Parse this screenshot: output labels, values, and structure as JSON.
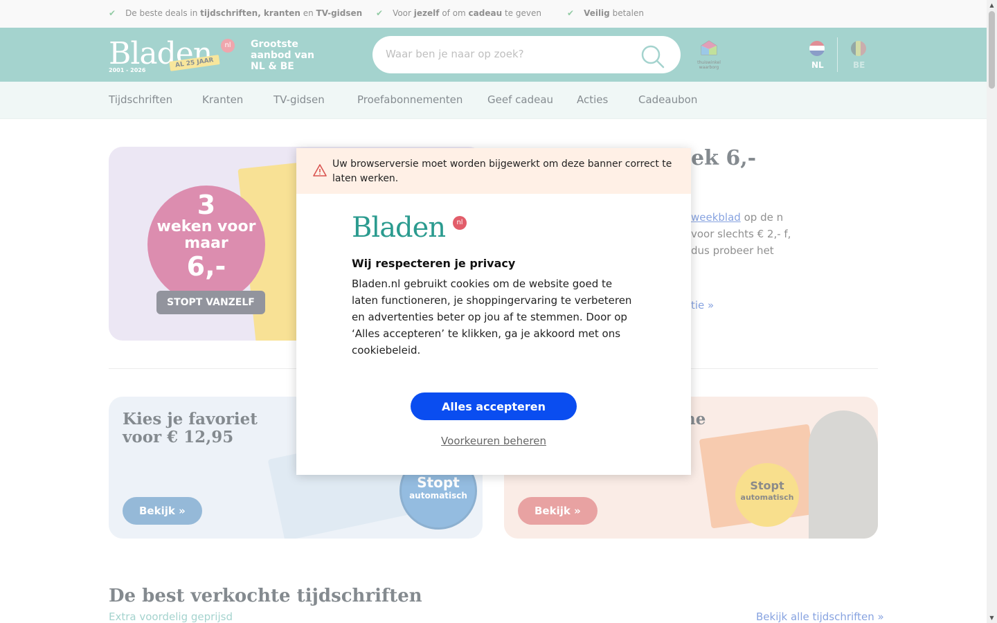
{
  "usp_bar": {
    "items": [
      {
        "parts": [
          "De beste deals in ",
          "tijdschriften, kranten",
          " en ",
          "TV-gidsen"
        ]
      },
      {
        "parts": [
          "Voor ",
          "jezelf",
          " of om ",
          "cadeau",
          " te geven"
        ]
      },
      {
        "parts": [
          "",
          "Veilig",
          " betalen"
        ]
      }
    ]
  },
  "header": {
    "logo_text": "Bladen",
    "logo_tld": "nl",
    "logo_years": "2001 - 2026",
    "logo_badge": "AL 25 JAAR",
    "tagline": "Grootste aanbod van NL & BE",
    "search_placeholder": "Waar ben je naar op zoek?",
    "thuiswinkel_label": "thuiswinkel waarborg",
    "languages": [
      {
        "code": "NL",
        "active": true
      },
      {
        "code": "BE",
        "active": false
      }
    ]
  },
  "nav": {
    "items": [
      "Tijdschriften",
      "Kranten",
      "TV-gidsen",
      "Proefabonnementen",
      "Geef cadeau",
      "Acties",
      "Cadeaubon"
    ]
  },
  "hero": {
    "circle_number": "3",
    "circle_weeks": "weken voor maar",
    "circle_price": "6,-",
    "stop_label": "STOPT VANZELF",
    "title_partial": "ek 6,-",
    "body_link": "weekblad",
    "body_text": " op de n voor slechts € 2,- f, dus probeer het",
    "more_link": "tie »"
  },
  "cards": [
    {
      "title": "Kies je favoriet voor € 12,95",
      "button": "Bekijk »",
      "stop_big": "Stopt",
      "stop_small": "automatisch"
    },
    {
      "title": "ne",
      "button": "Bekijk »",
      "stop_big": "Stopt",
      "stop_small": "automatisch"
    }
  ],
  "section": {
    "title": "De best verkochte tijdschriften",
    "subtitle": "Extra voordelig geprijsd",
    "link": "Bekijk alle tijdschriften »"
  },
  "modal": {
    "warning": "Uw browserversie moet worden bijgewerkt om deze banner correct te laten werken.",
    "logo_text": "Bladen",
    "logo_tld": "nl",
    "title": "Wij respecteren je privacy",
    "body": "Bladen.nl gebruikt cookies om de website goed te laten functioneren, je shoppingervaring te verbeteren en advertenties beter op jou af te stemmen. Door op ‘Alles accepteren’ te klikken, ga je akkoord met ons cookiebeleid.",
    "accept_label": "Alles accepteren",
    "prefs_label": "Voorkeuren beheren"
  },
  "colors": {
    "brand_teal": "#5aafa6",
    "accept_blue": "#0a4df0",
    "warning_bg": "#fff0e6",
    "logo_dot": "#e25d6a"
  },
  "icons": [
    "check-icon",
    "search-icon",
    "warning-icon",
    "flag-nl-icon",
    "flag-be-icon",
    "thuiswinkel-icon"
  ]
}
